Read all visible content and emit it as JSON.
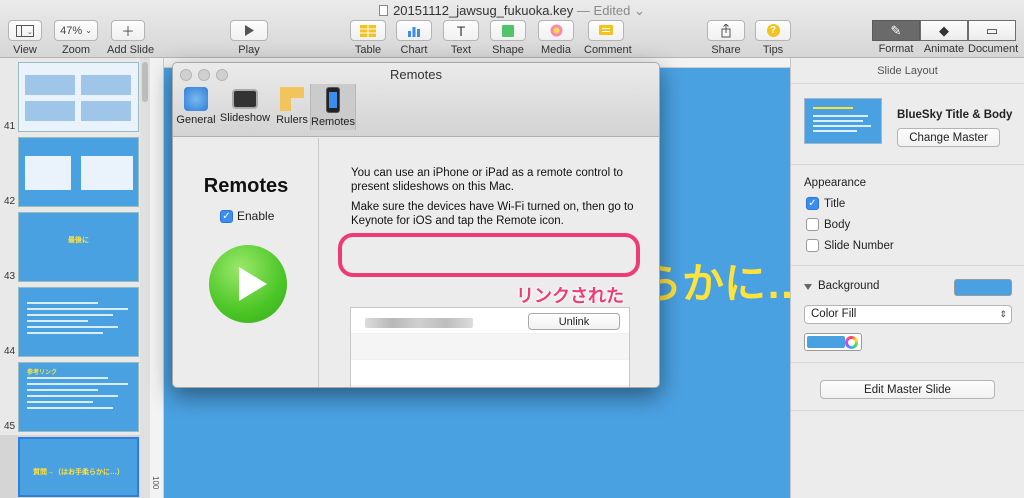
{
  "window": {
    "filename": "20151112_jawsug_fukuoka.key",
    "status": "— Edited",
    "status_chevron": "⌄"
  },
  "toolbar": {
    "view_label": "View",
    "zoom_value": "47%",
    "zoom_label": "Zoom",
    "add_slide_label": "Add Slide",
    "play_label": "Play",
    "table_label": "Table",
    "chart_label": "Chart",
    "text_label": "Text",
    "text_icon": "T",
    "shape_label": "Shape",
    "media_label": "Media",
    "comment_label": "Comment",
    "share_label": "Share",
    "tips_label": "Tips",
    "tips_icon": "?",
    "format_label": "Format",
    "animate_label": "Animate",
    "document_label": "Document"
  },
  "navigator": {
    "slides": [
      {
        "number": "41",
        "title": ""
      },
      {
        "number": "42",
        "title": ""
      },
      {
        "number": "43",
        "title": "最後に"
      },
      {
        "number": "44",
        "title": ""
      },
      {
        "number": "45",
        "title": "参考リンク"
      },
      {
        "number": "",
        "title": "質問→（はお手柔らかに…）"
      }
    ]
  },
  "canvas": {
    "ruler_number": "100",
    "slide_text": "らかに…"
  },
  "prefs": {
    "title": "Remotes",
    "tabs": [
      {
        "label": "General",
        "icon": "gear-icon"
      },
      {
        "label": "Slideshow",
        "icon": "monitor-icon"
      },
      {
        "label": "Rulers",
        "icon": "ruler-icon"
      },
      {
        "label": "Remotes",
        "icon": "iphone-icon"
      }
    ],
    "heading": "Remotes",
    "enable_label": "Enable",
    "description": "You can use an iPhone or iPad as a remote control to present slideshows on this Mac.",
    "instructions": "Make sure the devices have Wi-Fi turned on, then go to Keynote for iOS and tap the Remote icon.",
    "unlink_label": "Unlink"
  },
  "annotation": {
    "text": "リンクされた",
    "color": "#ee3b74"
  },
  "inspector": {
    "header": "Slide Layout",
    "master_name": "BlueSky Title & Body",
    "change_master_label": "Change Master",
    "appearance_label": "Appearance",
    "title_label": "Title",
    "body_label": "Body",
    "slide_number_label": "Slide Number",
    "background_label": "Background",
    "fill_type": "Color Fill",
    "edit_master_label": "Edit Master Slide"
  },
  "colors": {
    "slide_blue": "#4aa1e2",
    "slide_yellow": "#ffe23a",
    "accent_blue": "#3b8ef0"
  }
}
